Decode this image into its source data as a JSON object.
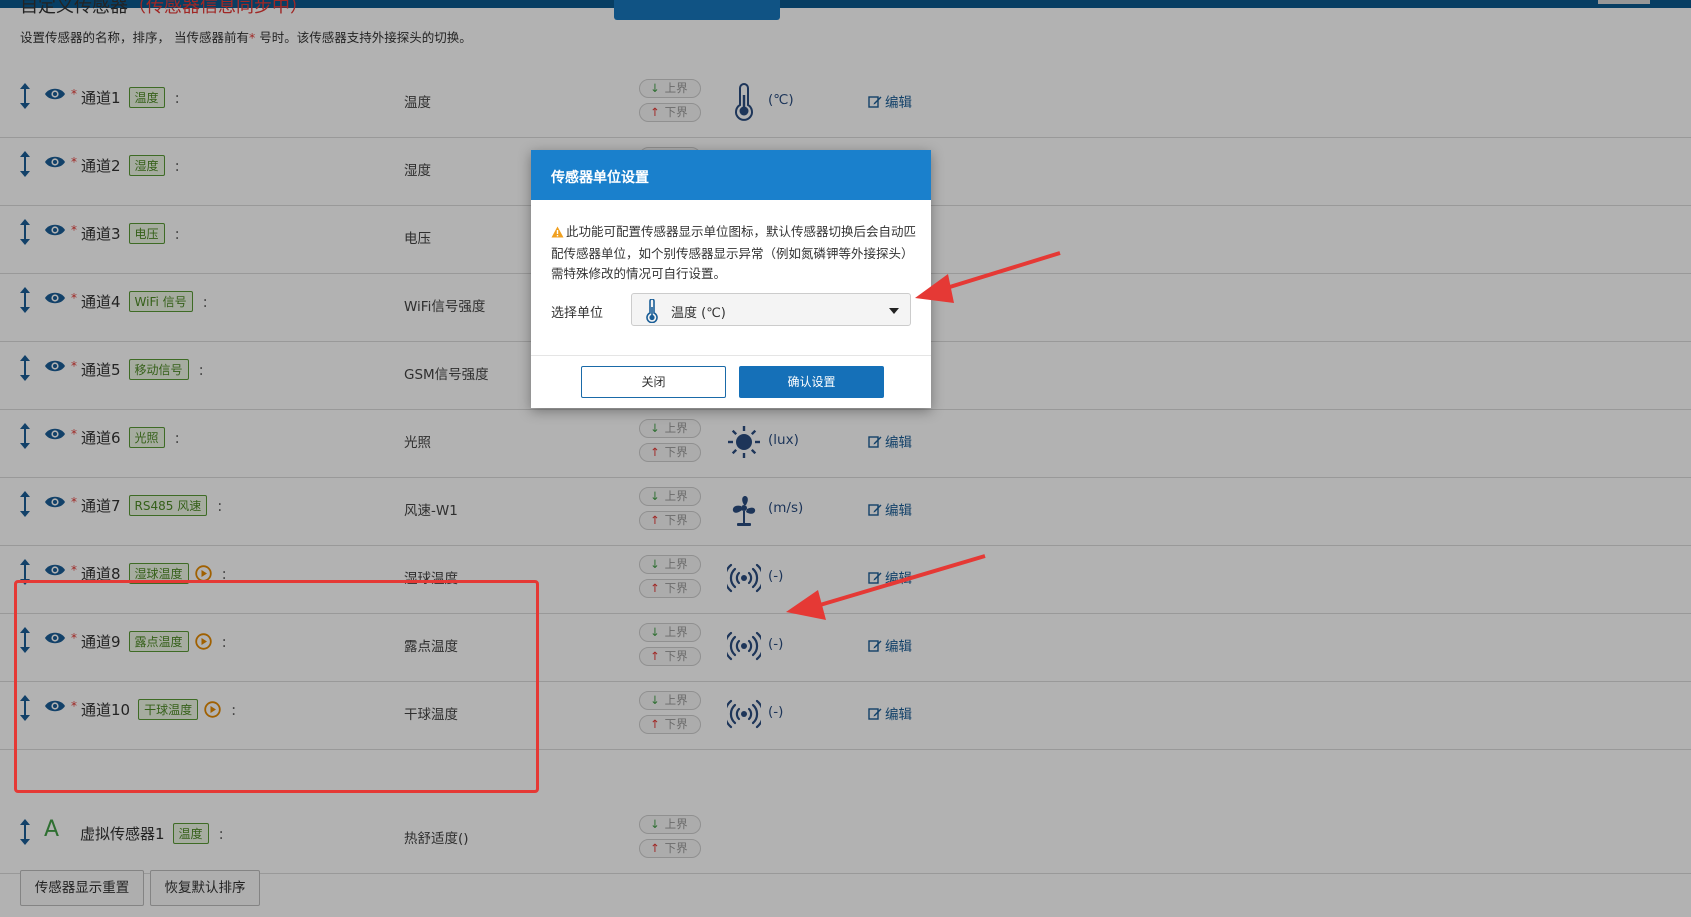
{
  "header": {
    "title": "自定义传感器",
    "title_note": "（传感器信息同步中）",
    "description_before": "设置传感器的名称，排序，  当传感器前有",
    "description_star": "*",
    "description_after": " 号时。该传感器支持外接探头的切换。"
  },
  "limits": {
    "upper_label": "上界",
    "lower_label": "下界"
  },
  "edit_label": "编辑",
  "rows": [
    {
      "name": "通道1",
      "tag": "温度",
      "desc": "温度",
      "unit": "(℃)",
      "icon": "thermometer-icon",
      "probe": false
    },
    {
      "name": "通道2",
      "tag": "湿度",
      "desc": "湿度",
      "unit": "",
      "icon": "",
      "probe": false
    },
    {
      "name": "通道3",
      "tag": "电压",
      "desc": "电压",
      "unit": "",
      "icon": "",
      "probe": false
    },
    {
      "name": "通道4",
      "tag": "WiFi 信号",
      "desc": "WiFi信号强度",
      "unit": "",
      "icon": "",
      "probe": false
    },
    {
      "name": "通道5",
      "tag": "移动信号",
      "desc": "GSM信号强度",
      "unit": "",
      "icon": "",
      "probe": false
    },
    {
      "name": "通道6",
      "tag": "光照",
      "desc": "光照",
      "unit": "(lux)",
      "icon": "sun-icon",
      "probe": false
    },
    {
      "name": "通道7",
      "tag": "RS485 风速",
      "desc": "风速-W1",
      "unit": "(m/s)",
      "icon": "fan-icon",
      "probe": false
    },
    {
      "name": "通道8",
      "tag": "湿球温度",
      "desc": "湿球温度",
      "unit": "(-)",
      "icon": "signal-icon",
      "probe": true
    },
    {
      "name": "通道9",
      "tag": "露点温度",
      "desc": "露点温度",
      "unit": "(-)",
      "icon": "signal-icon",
      "probe": true
    },
    {
      "name": "通道10",
      "tag": "干球温度",
      "desc": "干球温度",
      "unit": "(-)",
      "icon": "signal-icon",
      "probe": true
    }
  ],
  "virtual_row": {
    "icon_letter": "A",
    "name": "虚拟传感器1",
    "tag": "温度",
    "desc": "热舒适度()"
  },
  "footer": {
    "reset_label": "传感器显示重置",
    "restore_label": "恢复默认排序"
  },
  "modal": {
    "title": "传感器单位设置",
    "warning": "此功能可配置传感器显示单位图标，默认传感器切换后会自动匹配传感器单位，如个别传感器显示异常（例如氮磷钾等外接探头）需特殊修改的情况可自行设置。",
    "select_label": "选择单位",
    "select_value": "温度 (℃)",
    "close_label": "关闭",
    "confirm_label": "确认设置"
  },
  "colors": {
    "primary": "#1a80cc",
    "tag_green": "#4c8a24",
    "annotation_red": "#e53935"
  }
}
